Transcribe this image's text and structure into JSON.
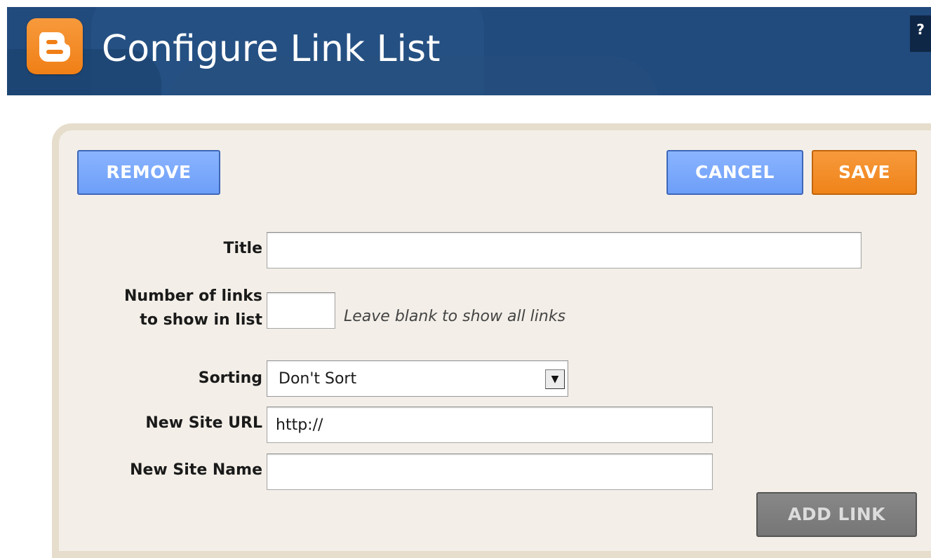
{
  "header": {
    "title": "Configure Link List",
    "logo_letter": "B",
    "help_label": "?"
  },
  "toolbar": {
    "remove_label": "REMOVE",
    "cancel_label": "CANCEL",
    "save_label": "SAVE"
  },
  "form": {
    "title_label": "Title",
    "title_value": "",
    "num_links_label_line1": "Number of links",
    "num_links_label_line2": "to show in list",
    "num_links_value": "",
    "num_links_hint": "Leave blank to show all links",
    "sorting_label": "Sorting",
    "sorting_value": "Don't Sort",
    "new_url_label": "New Site URL",
    "new_url_value": "http://",
    "new_name_label": "New Site Name",
    "new_name_value": "",
    "add_link_label": "ADD LINK"
  },
  "colors": {
    "header_bg": "#214a7d",
    "brand_orange": "#f07f16",
    "button_blue": "#6d9ef8",
    "panel_bg": "#f3efe8",
    "disabled_gray": "#767676"
  },
  "icons": {
    "logo": "blogger-logo-icon",
    "dropdown": "chevron-down-icon"
  }
}
